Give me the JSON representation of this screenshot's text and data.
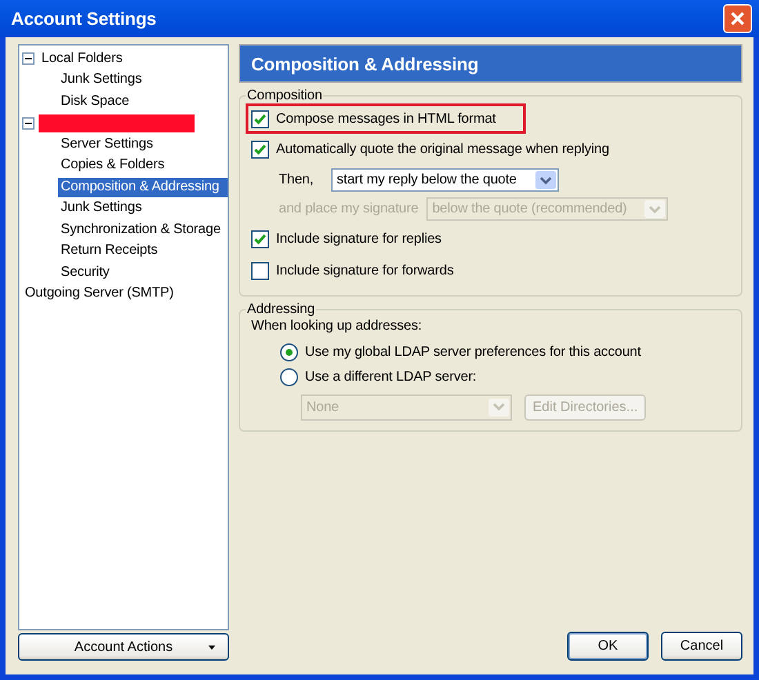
{
  "window": {
    "title": "Account Settings"
  },
  "tree": [
    {
      "kind": "folder",
      "label": "Local Folders",
      "expanded": true,
      "selected": false,
      "children": [
        {
          "kind": "page",
          "label": "Junk Settings",
          "selected": false
        },
        {
          "kind": "page",
          "label": "Disk Space",
          "selected": false
        }
      ]
    },
    {
      "kind": "redacted",
      "expanded": true,
      "children": [
        {
          "kind": "page",
          "label": "Server Settings",
          "selected": false
        },
        {
          "kind": "page",
          "label": "Copies & Folders",
          "selected": false
        },
        {
          "kind": "page",
          "label": "Composition & Addressing",
          "selected": true
        },
        {
          "kind": "page",
          "label": "Junk Settings",
          "selected": false
        },
        {
          "kind": "page",
          "label": "Synchronization & Storage",
          "selected": false
        },
        {
          "kind": "page",
          "label": "Return Receipts",
          "selected": false
        },
        {
          "kind": "page",
          "label": "Security",
          "selected": false
        }
      ]
    },
    {
      "kind": "page",
      "label": "Outgoing Server (SMTP)",
      "selected": false
    }
  ],
  "account_actions": {
    "label": "Account Actions"
  },
  "page_title": "Composition & Addressing",
  "composition": {
    "title": "Composition",
    "items": [
      {
        "kind": "checkbox",
        "label": "Compose messages in HTML format",
        "checked": true,
        "highlighted": true
      },
      {
        "kind": "checkbox",
        "label": "Automatically quote the original message when replying",
        "checked": true,
        "highlighted": false
      },
      {
        "kind": "select",
        "label": "Then,",
        "value": "start my reply below the quote",
        "disabled": false
      },
      {
        "kind": "select",
        "label": "and place my signature",
        "value": "below the quote (recommended)",
        "disabled": true
      },
      {
        "kind": "checkbox",
        "label": "Include signature for replies",
        "checked": true,
        "highlighted": false
      },
      {
        "kind": "checkbox",
        "label": "Include signature for forwards",
        "checked": false,
        "highlighted": false
      }
    ]
  },
  "addressing": {
    "title": "Addressing",
    "prompt": "When looking up addresses:",
    "items": [
      {
        "kind": "radio",
        "label": "Use my global LDAP server preferences for this account",
        "selected": true
      },
      {
        "kind": "radio",
        "label": "Use a different LDAP server:",
        "selected": false
      },
      {
        "kind": "directory",
        "value": "None",
        "disabled": true,
        "button": "Edit Directories...",
        "button_disabled": true
      }
    ]
  },
  "buttons": [
    {
      "label": "OK",
      "default": true
    },
    {
      "label": "Cancel",
      "default": false
    }
  ]
}
